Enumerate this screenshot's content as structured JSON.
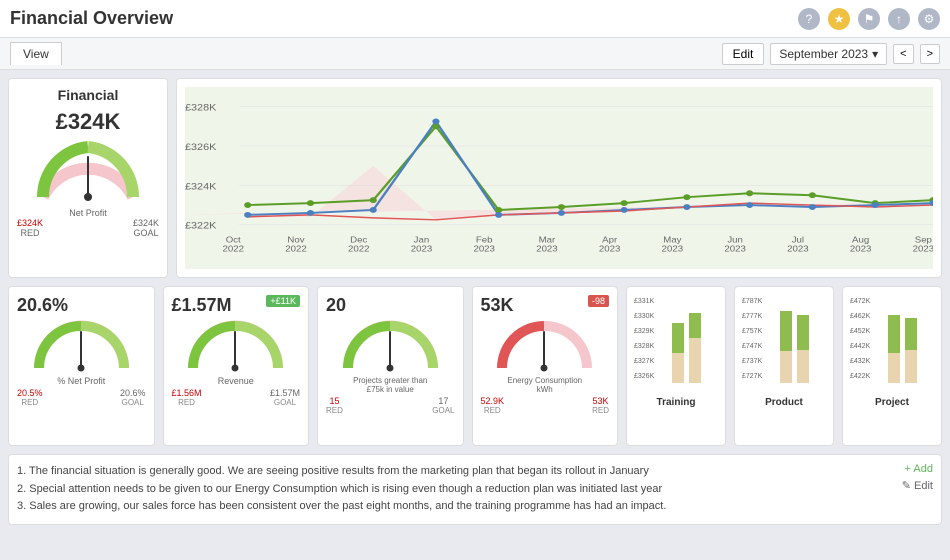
{
  "header": {
    "title": "Financial Overview",
    "icons": [
      "?",
      "★",
      "⚑",
      "↑",
      "⚙"
    ]
  },
  "toolbar": {
    "view_label": "View",
    "edit_label": "Edit",
    "date_label": "September 2023",
    "nav_prev": "<",
    "nav_next": ">"
  },
  "financial_card": {
    "title": "Financial",
    "value": "£324K",
    "sub_label": "Net Profit",
    "red_label": "£324K",
    "red_sub": "RED",
    "goal_label": "£324K",
    "goal_sub": "GOAL"
  },
  "metrics": [
    {
      "value": "20.6%",
      "badge": null,
      "label": "% Net Profit",
      "red_val": "20.5%",
      "red_sub": "RED",
      "goal_val": "20.6%",
      "goal_sub": "GOAL",
      "gauge_type": "profit"
    },
    {
      "value": "£1.57M",
      "badge": "+£11K",
      "badge_color": "green",
      "label": "Revenue",
      "red_val": "£1.56M",
      "red_sub": "RED",
      "goal_val": "£1.57M",
      "goal_sub": "GOAL",
      "gauge_type": "revenue"
    },
    {
      "value": "20",
      "badge": null,
      "label": "Projects greater than\n£75k in value",
      "red_val": "15",
      "red_sub": "RED",
      "goal_val": "17",
      "goal_sub": "GOAL",
      "gauge_type": "projects"
    },
    {
      "value": "53K",
      "badge": "-98",
      "badge_color": "red",
      "label": "Energy Consumption\nkWh",
      "red_val": "52.9K",
      "red_sub": "RED",
      "goal_val": "53K",
      "goal_sub": "RED",
      "gauge_type": "energy"
    }
  ],
  "mini_charts": [
    {
      "label": "Training",
      "color1": "#8fbc4f",
      "color2": "#e8d5b0"
    },
    {
      "label": "Product",
      "color1": "#8fbc4f",
      "color2": "#e8d5b0"
    },
    {
      "label": "Project",
      "color1": "#8fbc4f",
      "color2": "#e8d5b0"
    }
  ],
  "chart": {
    "y_labels": [
      "£328K",
      "£326K",
      "£324K",
      "£322K"
    ],
    "x_labels": [
      "Oct\n2022",
      "Nov\n2022",
      "Dec\n2022",
      "Jan\n2023",
      "Feb\n2023",
      "Mar\n2023",
      "Apr\n2023",
      "May\n2023",
      "Jun\n2023",
      "Jul\n2023",
      "Aug\n2023",
      "Sep\n2023"
    ]
  },
  "notes": {
    "items": [
      "1. The financial situation is generally good. We are seeing positive results from the marketing plan that began its rollout in January",
      "2. Special attention needs to be given to our Energy Consumption which is rising even though a reduction plan was initiated last year",
      "3. Sales are growing, our sales force has been consistent over the past eight months, and the training programme has had an impact."
    ],
    "add_label": "+ Add",
    "edit_label": "✎ Edit"
  }
}
